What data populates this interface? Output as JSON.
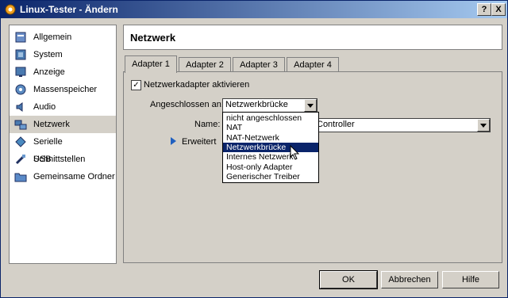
{
  "window": {
    "title": "Linux-Tester - Ändern",
    "help_btn": "?",
    "close_btn": "X"
  },
  "sidebar": {
    "items": [
      {
        "label": "Allgemein",
        "icon": "general-icon"
      },
      {
        "label": "System",
        "icon": "system-icon"
      },
      {
        "label": "Anzeige",
        "icon": "display-icon"
      },
      {
        "label": "Massenspeicher",
        "icon": "storage-icon"
      },
      {
        "label": "Audio",
        "icon": "audio-icon"
      },
      {
        "label": "Netzwerk",
        "icon": "network-icon",
        "selected": true
      },
      {
        "label": "Serielle Schnittstellen",
        "icon": "serial-port-icon"
      },
      {
        "label": "USB",
        "icon": "usb-icon"
      },
      {
        "label": "Gemeinsame Ordner",
        "icon": "shared-folder-icon"
      }
    ]
  },
  "main": {
    "heading": "Netzwerk",
    "tabs": [
      {
        "label": "Adapter 1",
        "active": true
      },
      {
        "label": "Adapter 2"
      },
      {
        "label": "Adapter 3"
      },
      {
        "label": "Adapter 4"
      }
    ],
    "enable_checkbox": {
      "label": "Netzwerkadapter aktivieren",
      "checked": true,
      "mark": "✓"
    },
    "attached_label": "Angeschlossen an:",
    "attached_value": "Netzwerkbrücke",
    "name_label": "Name:",
    "name_value": "Controller",
    "advanced_label": "Erweitert",
    "dropdown_options": [
      "nicht angeschlossen",
      "NAT",
      "NAT-Netzwerk",
      "Netzwerkbrücke",
      "Internes Netzwerk",
      "Host-only Adapter",
      "Generischer Treiber"
    ],
    "dropdown_selected": "Netzwerkbrücke"
  },
  "footer": {
    "ok": "OK",
    "cancel": "Abbrechen",
    "help": "Hilfe"
  },
  "colors": {
    "title_start": "#0a246a",
    "title_end": "#a6caf0",
    "selection": "#0a246a",
    "dialog_bg": "#d4d0c8"
  }
}
